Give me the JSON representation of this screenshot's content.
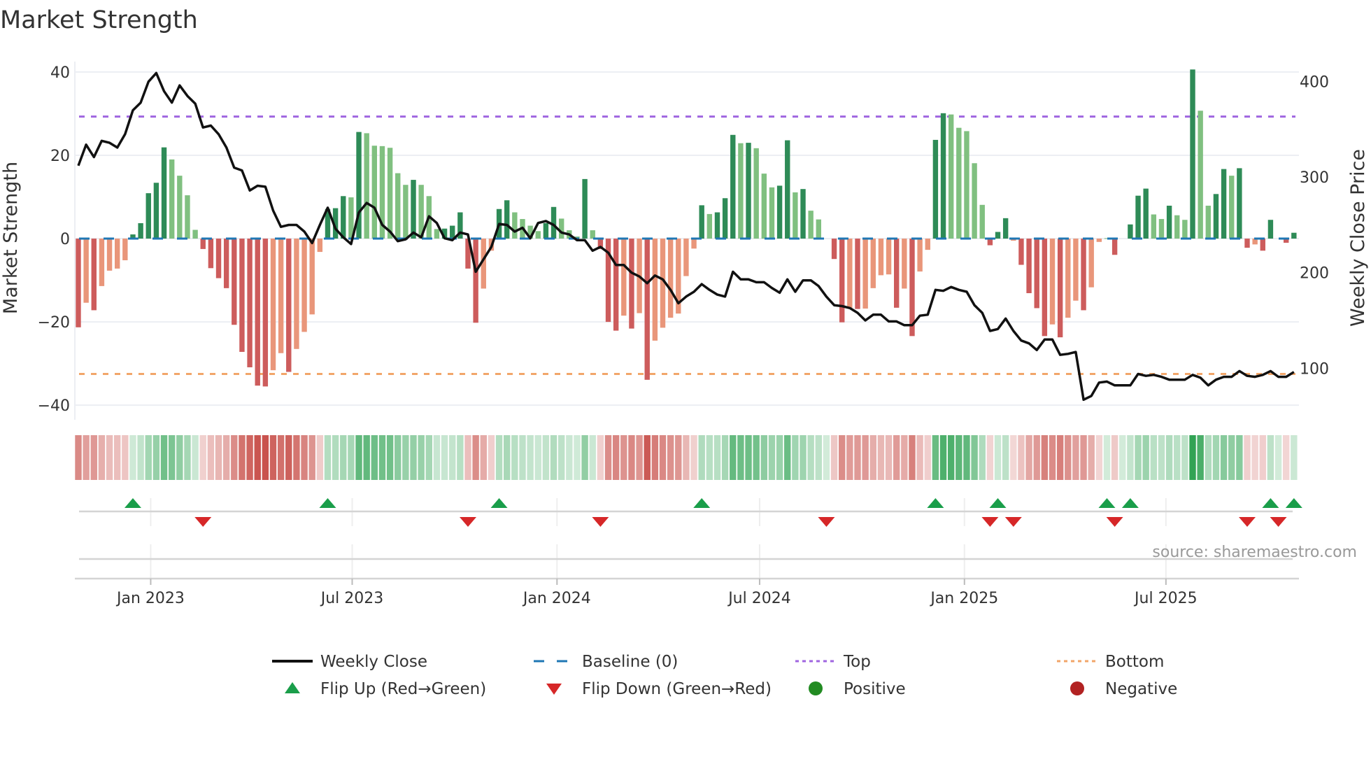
{
  "title": "Market Strength",
  "source": "source: sharemaestro.com",
  "chart_data": {
    "type": "bar",
    "title": "Market Strength",
    "x_start": "2022-10-28",
    "x_step_days": 7,
    "ylabel": "Market Strength",
    "y2label": "Weekly Close Price",
    "ylim": [
      -43.5,
      42.5
    ],
    "y2lim": [
      46,
      421
    ],
    "yticks": [
      40,
      20,
      0,
      -20,
      -40
    ],
    "ytick_labels": [
      "40",
      "20",
      "0",
      "−20",
      "−40"
    ],
    "y2ticks": [
      400,
      300,
      200,
      100
    ],
    "y2tick_labels": [
      "400",
      "300",
      "200",
      "100"
    ],
    "xticks": [
      {
        "date": "2023-01-01",
        "label": "Jan 2023"
      },
      {
        "date": "2023-07-01",
        "label": "Jul 2023"
      },
      {
        "date": "2024-01-01",
        "label": "Jan 2024"
      },
      {
        "date": "2024-07-01",
        "label": "Jul 2024"
      },
      {
        "date": "2025-01-01",
        "label": "Jan 2025"
      },
      {
        "date": "2025-07-01",
        "label": "Jul 2025"
      }
    ],
    "grid": true,
    "baseline": 0,
    "top_level": 29.3,
    "bottom_level": -32.5,
    "strength": [
      -21.3,
      -15.4,
      -17.2,
      -11.4,
      -7.7,
      -7.2,
      -5.2,
      1.0,
      3.7,
      10.9,
      13.4,
      21.9,
      19.0,
      15.1,
      10.4,
      2.1,
      -2.5,
      -7.1,
      -9.5,
      -11.9,
      -20.7,
      -27.2,
      -30.9,
      -35.3,
      -35.5,
      -31.6,
      -27.5,
      -32.0,
      -26.5,
      -22.4,
      -18.2,
      -3.2,
      7.1,
      7.3,
      10.2,
      9.9,
      25.6,
      25.3,
      22.3,
      22.2,
      21.8,
      15.7,
      12.9,
      14.1,
      12.9,
      10.2,
      2.3,
      2.4,
      3.1,
      6.3,
      -7.2,
      -20.2,
      -12.0,
      -2.9,
      7.1,
      9.2,
      6.3,
      4.7,
      3.1,
      1.8,
      3.7,
      7.6,
      4.8,
      2.0,
      0.5,
      14.3,
      2.0,
      -2.5,
      -20.0,
      -22.1,
      -18.5,
      -21.6,
      -17.9,
      -33.9,
      -24.5,
      -21.4,
      -19.0,
      -18.0,
      -9.0,
      -2.4,
      8.0,
      5.9,
      6.3,
      9.7,
      24.9,
      22.9,
      23.0,
      21.7,
      15.6,
      12.3,
      12.7,
      23.6,
      11.1,
      11.9,
      6.7,
      4.6,
      0,
      -4.9,
      -20.1,
      -16.6,
      -16.9,
      -16.8,
      -11.9,
      -8.8,
      -8.6,
      -16.6,
      -12.0,
      -23.4,
      -7.9,
      -2.7,
      23.7,
      30.1,
      29.8,
      26.6,
      25.8,
      18.1,
      8.1,
      -1.6,
      1.6,
      4.9,
      -0.5,
      -6.3,
      -13.1,
      -16.7,
      -23.4,
      -20.6,
      -23.7,
      -19.0,
      -14.9,
      -17.2,
      -11.7,
      -0.8,
      0.1,
      -3.9,
      0,
      3.4,
      10.3,
      12.0,
      5.8,
      4.7,
      7.9,
      5.6,
      4.5,
      40.6,
      30.7,
      7.9,
      10.7,
      16.7,
      15.1,
      16.9,
      -2.2,
      -1.4,
      -2.9,
      4.5,
      0,
      -1.0,
      1.4
    ],
    "weekly_close": [
      312,
      334,
      321,
      338,
      336,
      331,
      345,
      370,
      378,
      400,
      409,
      390,
      378,
      396,
      385,
      377,
      352,
      354,
      345,
      331,
      310,
      307,
      286,
      291,
      290,
      265,
      248,
      250,
      250,
      243,
      231,
      250,
      268,
      246,
      237,
      230,
      263,
      273,
      268,
      250,
      243,
      233,
      235,
      242,
      237,
      259,
      252,
      236,
      234,
      242,
      240,
      201,
      214,
      227,
      251,
      250,
      243,
      247,
      236,
      252,
      254,
      250,
      242,
      240,
      234,
      234,
      223,
      227,
      221,
      208,
      208,
      200,
      196,
      189,
      197,
      193,
      182,
      168,
      175,
      180,
      188,
      182,
      177,
      175,
      201,
      193,
      193,
      190,
      190,
      184,
      179,
      193,
      180,
      192,
      192,
      186,
      175,
      166,
      165,
      163,
      158,
      150,
      156,
      156,
      149,
      149,
      145,
      145,
      155,
      156,
      182,
      181,
      185,
      182,
      180,
      166,
      158,
      139,
      141,
      152,
      139,
      129,
      126,
      119,
      130,
      130,
      114,
      115,
      117,
      67,
      71,
      85,
      86,
      82,
      82,
      82,
      94,
      92,
      93,
      91,
      88,
      88,
      88,
      93,
      90,
      82,
      88,
      91,
      91,
      97,
      92,
      91,
      93,
      97,
      91,
      91,
      96
    ],
    "flip_up_weeks": [
      7,
      32,
      54,
      80,
      110,
      118,
      132,
      135,
      153,
      156
    ],
    "flip_down_weeks": [
      16,
      50,
      67,
      96,
      117,
      120,
      133,
      150,
      154
    ],
    "legend": {
      "placement": "bottom",
      "items": [
        {
          "label": "Weekly Close",
          "kind": "line-solid",
          "color": "#111111"
        },
        {
          "label": "Baseline (0)",
          "kind": "line-dashed",
          "color": "#1f77b4"
        },
        {
          "label": "Top",
          "kind": "line-dotted",
          "color": "#a066e0"
        },
        {
          "label": "Bottom",
          "kind": "line-dotted",
          "color": "#f2a66a"
        },
        {
          "label": "Flip Up (Red→Green)",
          "kind": "triangle-up",
          "color": "#1a9e4a"
        },
        {
          "label": "Flip Down (Green→Red)",
          "kind": "triangle-down",
          "color": "#d62728"
        },
        {
          "label": "Positive",
          "kind": "circle",
          "color": "#228b22"
        },
        {
          "label": "Negative",
          "kind": "circle",
          "color": "#b22222"
        }
      ]
    },
    "colors": {
      "pos_strong": "#2e8b57",
      "pos_weak": "#80c080",
      "neg_strong": "#cd5c5c",
      "neg_weak": "#e9967a",
      "strip_pos": "49,163,84",
      "strip_neg": "200,80,74",
      "price": "#111111",
      "grid": "#eceef3",
      "axis": "#d4d4d4"
    }
  }
}
